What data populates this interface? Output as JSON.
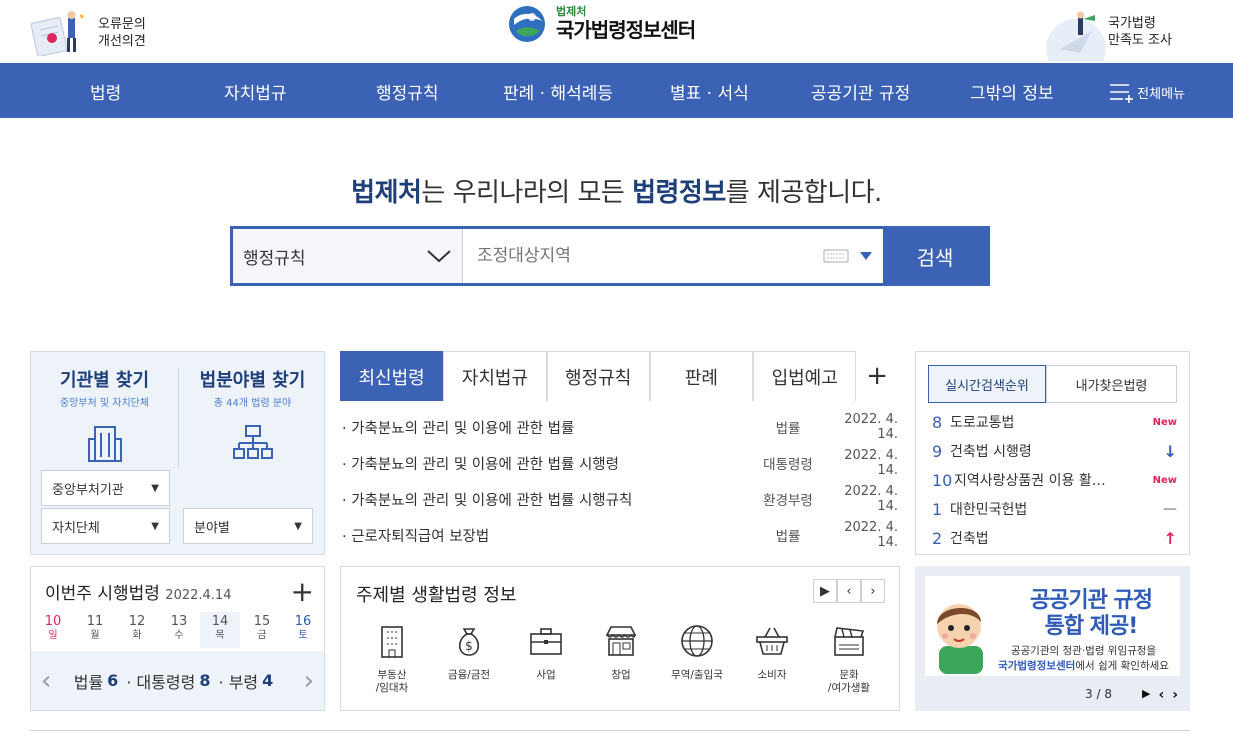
{
  "header": {
    "feedback_line1": "오류문의",
    "feedback_line2": "개선의견",
    "logo_small": "법제처",
    "logo_big": "국가법령정보센터",
    "survey_line1": "국가법령",
    "survey_line2": "만족도 조사"
  },
  "nav": {
    "items": [
      "법령",
      "자치법규",
      "행정규칙",
      "판례 · 해석례등",
      "별표 · 서식",
      "공공기관 규정",
      "그밖의 정보"
    ],
    "allmenu": "전체메뉴"
  },
  "headline": {
    "part1": "법제처",
    "part2": "는 우리나라의 모든 ",
    "part3": "법령정보",
    "part4": "를 제공합니다."
  },
  "search": {
    "category": "행정규칙",
    "placeholder": "조정대상지역",
    "button": "검색"
  },
  "finder": {
    "agency_title": "기관별 찾기",
    "agency_sub": "중앙부처 및 자치단체",
    "field_title": "법분야별 찾기",
    "field_sub": "총 44개 법령 분야",
    "select_central": "중앙부처기관",
    "select_local": "자치단체",
    "select_field": "분야별"
  },
  "news": {
    "tabs": [
      "최신법령",
      "자치법규",
      "행정규칙",
      "판례",
      "입법예고"
    ],
    "rows": [
      {
        "title": "· 가축분뇨의 관리 및 이용에 관한 법률",
        "type": "법률",
        "date": "2022. 4. 14."
      },
      {
        "title": "· 가축분뇨의 관리 및 이용에 관한 법률 시행령",
        "type": "대통령령",
        "date": "2022. 4. 14."
      },
      {
        "title": "· 가축분뇨의 관리 및 이용에 관한 법률 시행규칙",
        "type": "환경부령",
        "date": "2022. 4. 14."
      },
      {
        "title": "· 근로자퇴직급여 보장법",
        "type": "법률",
        "date": "2022. 4. 14."
      }
    ]
  },
  "rank": {
    "tab_realtime": "실시간검색순위",
    "tab_mine": "내가찾은법령",
    "rows": [
      {
        "num": "8",
        "name": "도로교통법",
        "badge": "New",
        "color": "#e0245e"
      },
      {
        "num": "9",
        "name": "건축법 시행령",
        "badge": "↓",
        "color": "#2f5bb8"
      },
      {
        "num": "10",
        "name": "지역사랑상품권 이용 활…",
        "badge": "New",
        "color": "#e0245e"
      },
      {
        "num": "1",
        "name": "대한민국헌법",
        "badge": "—",
        "color": "#aaaaaa"
      },
      {
        "num": "2",
        "name": "건축법",
        "badge": "↑",
        "color": "#e0245e"
      }
    ]
  },
  "week": {
    "title": "이번주 시행법령",
    "date": "2022.4.14",
    "days": [
      {
        "d": "10",
        "w": "일",
        "color": "#e0245e"
      },
      {
        "d": "11",
        "w": "월",
        "color": "#555555"
      },
      {
        "d": "12",
        "w": "화",
        "color": "#555555"
      },
      {
        "d": "13",
        "w": "수",
        "color": "#555555"
      },
      {
        "d": "14",
        "w": "목",
        "color": "#555555"
      },
      {
        "d": "15",
        "w": "금",
        "color": "#555555"
      },
      {
        "d": "16",
        "w": "토",
        "color": "#2f5bb8"
      }
    ],
    "law_label": "법률",
    "law_count": "6",
    "pres_label": "· 대통령령",
    "pres_count": "8",
    "min_label": "· 부령",
    "min_count": "4"
  },
  "life": {
    "title": "주제별 생활법령 정보",
    "items": [
      {
        "label": "부동산\n/임대차",
        "icon": "building-icon"
      },
      {
        "label": "금융/금전",
        "icon": "moneybag-icon"
      },
      {
        "label": "사업",
        "icon": "briefcase-icon"
      },
      {
        "label": "창업",
        "icon": "store-icon"
      },
      {
        "label": "무역/출입국",
        "icon": "globe-icon"
      },
      {
        "label": "소비자",
        "icon": "basket-icon"
      },
      {
        "label": "문화\n/여가생활",
        "icon": "clapper-icon"
      }
    ]
  },
  "banner": {
    "line1": "공공기관 규정",
    "line2": "통합 제공!",
    "sub1": "공공기관의 정관·법령 위임규정을",
    "sub2_em": "국가법령정보센터",
    "sub2_rest": "에서 쉽게 확인하세요",
    "page": "3 / 8"
  },
  "colors": {
    "primary": "#3b62b4",
    "dark": "#1e3f7a",
    "accent_red": "#e0245e"
  }
}
